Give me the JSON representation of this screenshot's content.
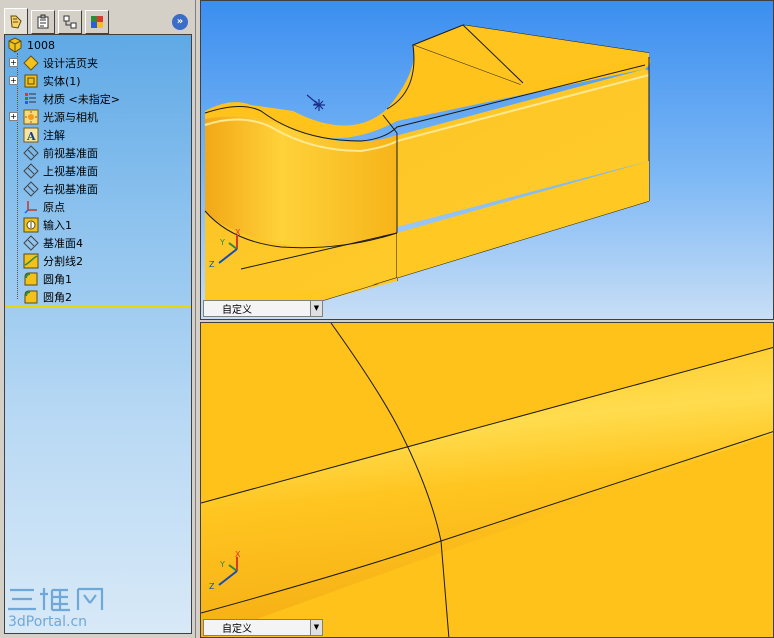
{
  "tabs": [
    {
      "name": "featuremanager",
      "icon": "featuremanager-tree-icon"
    },
    {
      "name": "propertymanager",
      "icon": "propertymanager-icon"
    },
    {
      "name": "configurationmanager",
      "icon": "configurationmanager-icon"
    },
    {
      "name": "displaymanager",
      "icon": "displaymanager-icon"
    }
  ],
  "expand_label": "»",
  "tree": {
    "root": "1008",
    "items": [
      {
        "label": "设计活页夹",
        "icon": "design-binder-icon",
        "expandable": true
      },
      {
        "label": "实体(1)",
        "icon": "solid-bodies-icon",
        "expandable": true
      },
      {
        "label": "材质 <未指定>",
        "icon": "material-icon",
        "expandable": false
      },
      {
        "label": "光源与相机",
        "icon": "lights-cameras-icon",
        "expandable": true
      },
      {
        "label": "注解",
        "icon": "annotations-icon",
        "expandable": false
      },
      {
        "label": "前视基准面",
        "icon": "plane-icon",
        "expandable": false
      },
      {
        "label": "上视基准面",
        "icon": "plane-icon",
        "expandable": false
      },
      {
        "label": "右视基准面",
        "icon": "plane-icon",
        "expandable": false
      },
      {
        "label": "原点",
        "icon": "origin-icon",
        "expandable": false
      },
      {
        "label": "输入1",
        "icon": "imported-body-icon",
        "expandable": false
      },
      {
        "label": "基准面4",
        "icon": "plane-icon",
        "expandable": false
      },
      {
        "label": "分割线2",
        "icon": "split-line-icon",
        "expandable": false
      },
      {
        "label": "圆角1",
        "icon": "fillet-icon",
        "expandable": false
      },
      {
        "label": "圆角2",
        "icon": "fillet-icon",
        "expandable": false
      }
    ]
  },
  "viewports": {
    "top": {
      "view": "自定义",
      "triad": {
        "x": "X",
        "y": "Y",
        "z": "Z"
      }
    },
    "bottom": {
      "view": "自定义",
      "triad": {
        "x": "X",
        "y": "Y",
        "z": "Z"
      }
    }
  },
  "watermark": {
    "logo": "三维网",
    "url": "3dPortal.cn"
  },
  "colors": {
    "model": "#ffc21a",
    "model_shadow": "#f0a818",
    "viewport_top": "#3b8ef0",
    "viewport_bottom": "#c8def5",
    "tree_top": "#5fa9e6"
  }
}
